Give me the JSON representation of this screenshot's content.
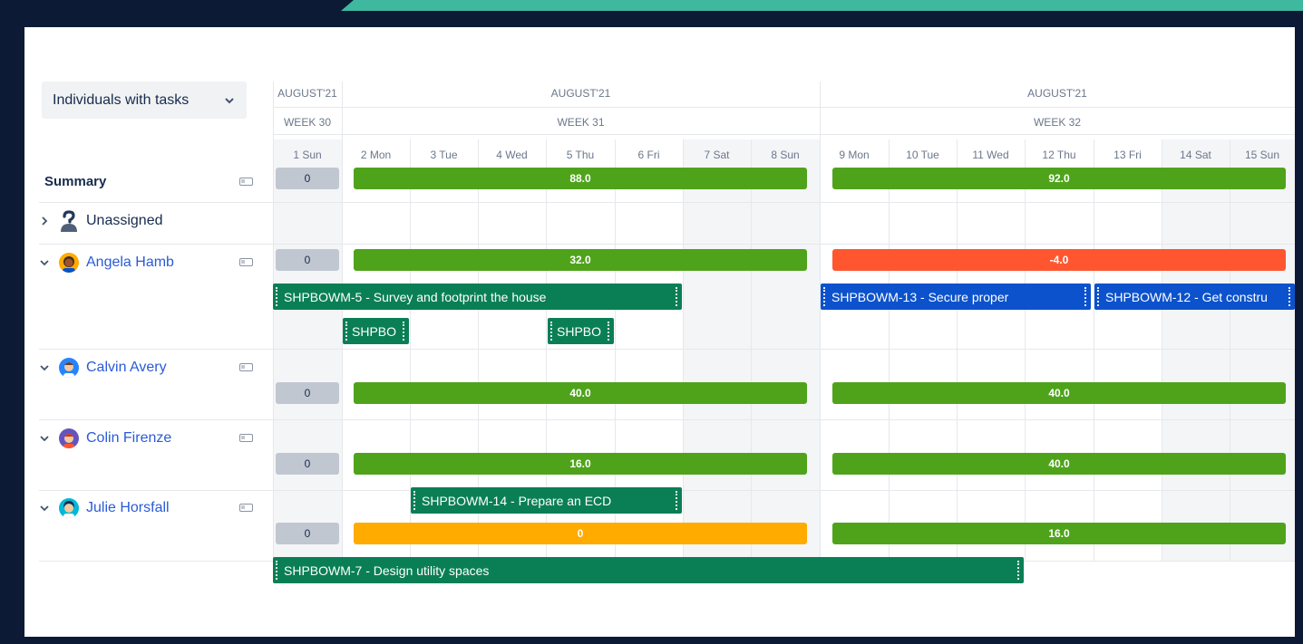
{
  "filter": {
    "label": "Individuals with tasks"
  },
  "header": {
    "months": [
      "AUGUST'21",
      "AUGUST'21",
      "AUGUST'21"
    ],
    "weeks": [
      "WEEK 30",
      "WEEK 31",
      "WEEK 32"
    ],
    "days": [
      "1 Sun",
      "2 Mon",
      "3 Tue",
      "4 Wed",
      "5 Thu",
      "6 Fri",
      "7 Sat",
      "8 Sun",
      "9 Mon",
      "10 Tue",
      "11 Wed",
      "12 Thu",
      "13 Fri",
      "14 Sat",
      "15 Sun"
    ]
  },
  "rows": {
    "summary": {
      "label": "Summary",
      "w30": "0",
      "w31": "88.0",
      "w32": "92.0"
    },
    "unassigned": {
      "label": "Unassigned"
    },
    "angela": {
      "label": "Angela Hamb",
      "w30": "0",
      "w31": "32.0",
      "w32": "-4.0"
    },
    "calvin": {
      "label": "Calvin Avery",
      "w30": "0",
      "w31": "40.0",
      "w32": "40.0"
    },
    "colin": {
      "label": "Colin Firenze",
      "w30": "0",
      "w31": "16.0",
      "w32": "40.0"
    },
    "julie": {
      "label": "Julie Horsfall",
      "w30": "0",
      "w31": "0",
      "w32": "16.0"
    }
  },
  "tasks": {
    "t5": "SHPBOWM-5 - Survey and footprint the house",
    "t13": "SHPBOWM-13 - Secure proper",
    "t12": "SHPBOWM-12 - Get constru",
    "small1": "SHPBO",
    "small2": "SHPBO",
    "t14": "SHPBOWM-14 - Prepare an ECD",
    "t7": "SHPBOWM-7 - Design utility spaces"
  },
  "colors": {
    "green": "#4fa31b",
    "red": "#ff5630",
    "amber": "#ffab00",
    "task_teal": "#0a7f56",
    "task_blue": "#0c52cc",
    "name_link": "#2a5bd7"
  },
  "icons": [
    "chevron-down-icon",
    "chevron-right-icon",
    "battery-icon",
    "unassigned-user-icon",
    "avatar-icon"
  ]
}
